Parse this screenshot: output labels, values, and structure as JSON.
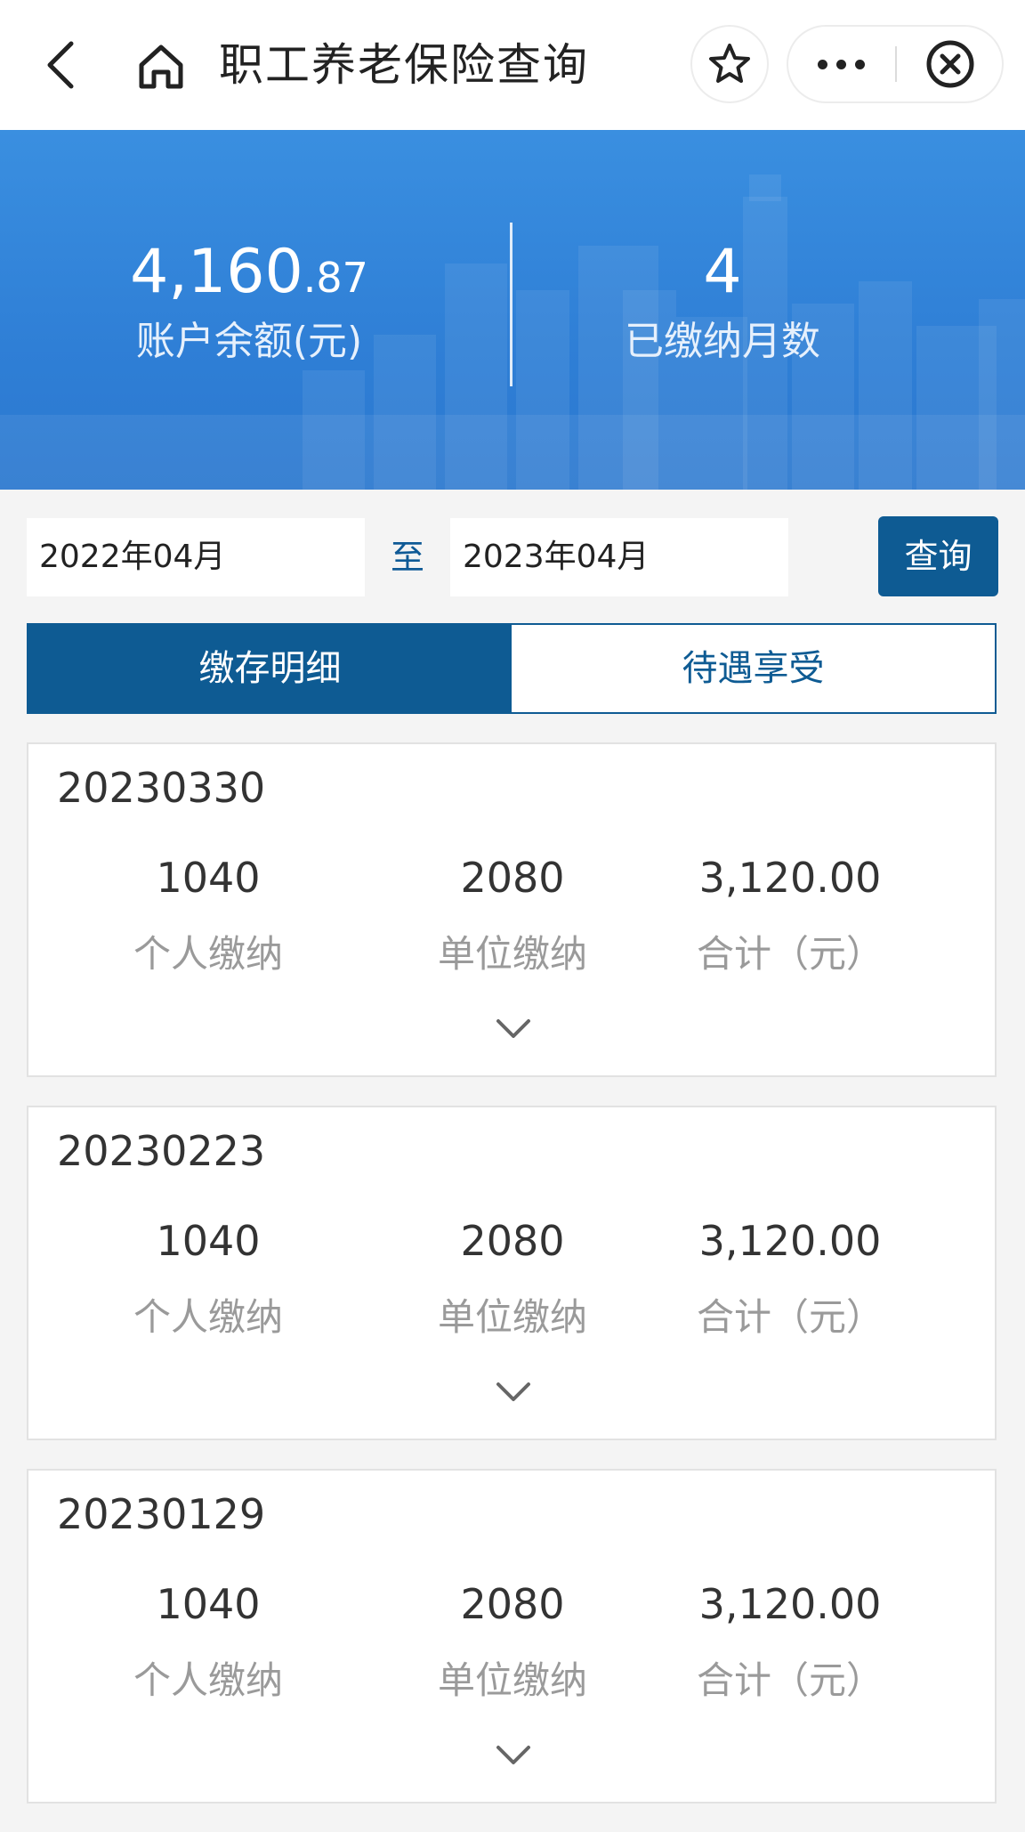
{
  "nav": {
    "title": "职工养老保险查询",
    "icons": {
      "back": "back-arrow-icon",
      "home": "home-icon",
      "favorite": "star-icon",
      "more": "more-icon",
      "close": "close-circle-icon"
    }
  },
  "summary": {
    "balance_int": "4,160",
    "balance_dec": ".87",
    "balance_label": "账户余额(元)",
    "months_value": "4",
    "months_label": "已缴纳月数"
  },
  "filter": {
    "start_date": "2022年04月",
    "separator": "至",
    "end_date": "2023年04月",
    "query_label": "查询"
  },
  "tabs": [
    {
      "label": "缴存明细",
      "active": true
    },
    {
      "label": "待遇享受",
      "active": false
    }
  ],
  "records": [
    {
      "date": "20230330",
      "personal": "1040",
      "personal_label": "个人缴纳",
      "employer": "2080",
      "employer_label": "单位缴纳",
      "total": "3,120.00",
      "total_label": "合计（元）"
    },
    {
      "date": "20230223",
      "personal": "1040",
      "personal_label": "个人缴纳",
      "employer": "2080",
      "employer_label": "单位缴纳",
      "total": "3,120.00",
      "total_label": "合计（元）"
    },
    {
      "date": "20230129",
      "personal": "1040",
      "personal_label": "个人缴纳",
      "employer": "2080",
      "employer_label": "单位缴纳",
      "total": "3,120.00",
      "total_label": "合计（元）"
    }
  ],
  "colors": {
    "brand": "#0e5b93",
    "hero": "#2f7fd6",
    "background": "#f4f4f4"
  }
}
